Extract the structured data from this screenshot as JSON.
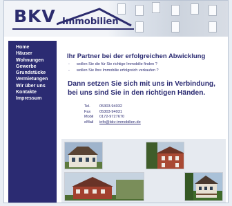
{
  "logo": {
    "name": "BKV",
    "subtitle": "Immobilien"
  },
  "nav": [
    "Home",
    "Häuser",
    "Wohnungen",
    "Gewerbe",
    "Grundstücke",
    "Vermietungen",
    "Wir über uns",
    "Kontakte",
    "Impressum"
  ],
  "headline": "Ihr Partner bei der erfolgreichen Abwicklung",
  "bullets": [
    "wollen Sie die für Sie richtige Immobilie finden ?",
    "wollen Sie Ihre Immobilie erfolgreich verkaufen ?"
  ],
  "bullet_marker": "-",
  "tagline_1": "Dann setzen Sie sich mit uns in Verbindung,",
  "tagline_2": "bei uns sind Sie in den richtigen Händen.",
  "contact": {
    "tel_label": "Tel.",
    "tel": "05303-94032",
    "fax_label": "Fax",
    "fax": "05303-94031",
    "mobil_label": "Mobil",
    "mobil": "0172-9727670",
    "email_label": "eMail",
    "email": "info@bkv-immobilien.de"
  },
  "colors": {
    "brand": "#2b2b72",
    "background": "#e9eef4"
  }
}
